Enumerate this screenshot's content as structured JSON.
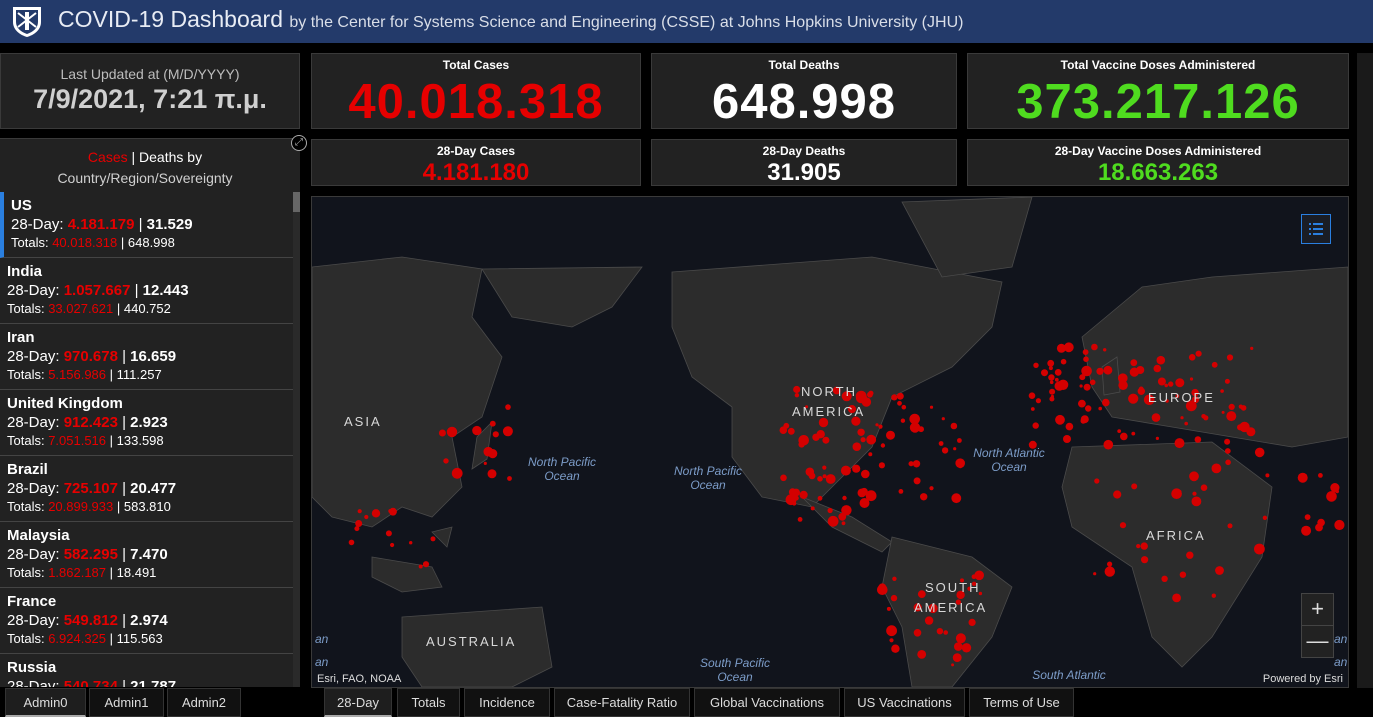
{
  "header": {
    "title": "COVID-19 Dashboard",
    "subtitle": "by the Center for Systems Science and Engineering (CSSE) at Johns Hopkins University (JHU)"
  },
  "last_updated": {
    "label": "Last Updated at (M/D/YYYY)",
    "value": "7/9/2021, 7:21 π.μ."
  },
  "stats": {
    "total_cases": {
      "label": "Total Cases",
      "value": "40.018.318",
      "color": "#e60000"
    },
    "total_deaths": {
      "label": "Total Deaths",
      "value": "648.998",
      "color": "#ffffff"
    },
    "total_vaccine": {
      "label": "Total Vaccine Doses Administered",
      "value": "373.217.126",
      "color": "#4fdc1f"
    },
    "cases_28": {
      "label": "28-Day Cases",
      "value": "4.181.180"
    },
    "deaths_28": {
      "label": "28-Day Deaths",
      "value": "31.905"
    },
    "vaccine_28": {
      "label": "28-Day Vaccine Doses Administered",
      "value": "18.663.263"
    }
  },
  "list": {
    "header_cases": "Cases",
    "header_sep": " | ",
    "header_deaths": "Deaths by",
    "header_line2": "Country/Region/Sovereignty",
    "day_prefix": "28-Day: ",
    "totals_prefix": "Totals: ",
    "sep": " | ",
    "rows": [
      {
        "name": "US",
        "cases28": "4.181.179",
        "deaths28": "31.529",
        "total_cases": "40.018.318",
        "total_deaths": "648.998"
      },
      {
        "name": "India",
        "cases28": "1.057.667",
        "deaths28": "12.443",
        "total_cases": "33.027.621",
        "total_deaths": "440.752"
      },
      {
        "name": "Iran",
        "cases28": "970.678",
        "deaths28": "16.659",
        "total_cases": "5.156.986",
        "total_deaths": "111.257"
      },
      {
        "name": "United Kingdom",
        "cases28": "912.423",
        "deaths28": "2.923",
        "total_cases": "7.051.516",
        "total_deaths": "133.598"
      },
      {
        "name": "Brazil",
        "cases28": "725.107",
        "deaths28": "20.477",
        "total_cases": "20.899.933",
        "total_deaths": "583.810"
      },
      {
        "name": "Malaysia",
        "cases28": "582.295",
        "deaths28": "7.470",
        "total_cases": "1.862.187",
        "total_deaths": "18.491"
      },
      {
        "name": "France",
        "cases28": "549.812",
        "deaths28": "2.974",
        "total_cases": "6.924.325",
        "total_deaths": "115.563"
      },
      {
        "name": "Russia",
        "cases28": "540.734",
        "deaths28": "21.787",
        "total_cases": "",
        "total_deaths": ""
      }
    ]
  },
  "map": {
    "labels": {
      "asia": "ASIA",
      "north_america_1": "NORTH",
      "north_america_2": "AMERICA",
      "europe": "EUROPE",
      "africa": "AFRICA",
      "south_america_1": "SOUTH",
      "south_america_2": "AMERICA",
      "australia": "AUSTRALIA"
    },
    "oceans": {
      "npac_w_1": "North Pacific",
      "npac_w_2": "Ocean",
      "npac_e_1": "North Pacific",
      "npac_e_2": "Ocean",
      "natl_1": "North Atlantic",
      "natl_2": "Ocean",
      "spac_1": "South Pacific",
      "spac_2": "Ocean",
      "satl": "South Atlantic",
      "edge_left_1": "an",
      "edge_right_1": "an",
      "edge_left_2": "an",
      "edge_right_2": "an"
    },
    "attribution_left": "Esri, FAO, NOAA",
    "attribution_right": "Powered by Esri",
    "zoom_in": "+",
    "zoom_out": "—",
    "dot_color": "#d40000"
  },
  "tabs_left": [
    "Admin0",
    "Admin1",
    "Admin2"
  ],
  "tabs_main": [
    "28-Day",
    "Totals",
    "Incidence",
    "Case-Fatality Ratio",
    "Global Vaccinations",
    "US Vaccinations",
    "Terms of Use"
  ]
}
